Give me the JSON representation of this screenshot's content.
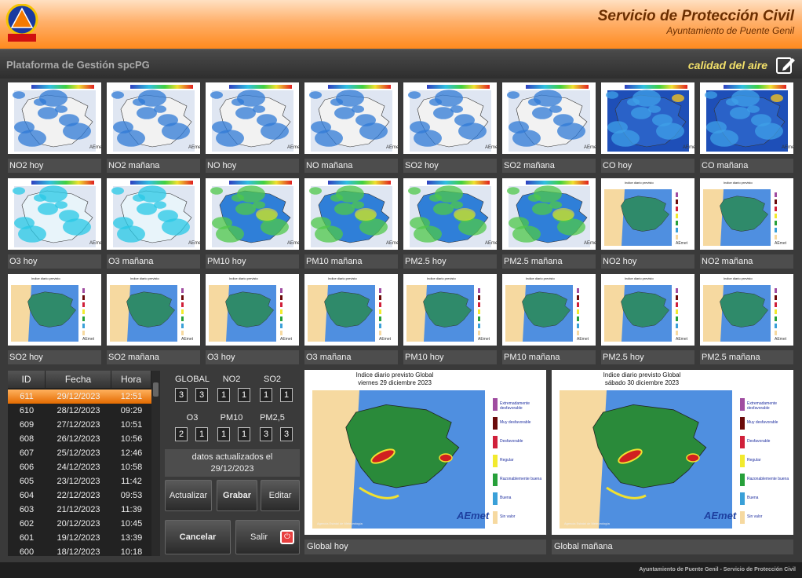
{
  "header": {
    "title": "Servicio de Protección Civil",
    "subtitle": "Ayuntamiento de Puente Genil",
    "logo_text": "PROTECCIÓN CIVIL Puente Genil"
  },
  "toolbar": {
    "platform": "Plataforma de Gestión spcPG",
    "section": "calidad del aire",
    "edit_icon": "edit-icon"
  },
  "rows": [
    [
      {
        "label": "NO2 hoy",
        "type": "grid"
      },
      {
        "label": "NO2 mañana",
        "type": "grid"
      },
      {
        "label": "NO hoy",
        "type": "grid"
      },
      {
        "label": "NO mañana",
        "type": "grid"
      },
      {
        "label": "SO2 hoy",
        "type": "grid"
      },
      {
        "label": "SO2 mañana",
        "type": "grid"
      },
      {
        "label": "CO hoy",
        "type": "dark"
      },
      {
        "label": "CO mañana",
        "type": "dark"
      }
    ],
    [
      {
        "label": "O3 hoy",
        "type": "cyan"
      },
      {
        "label": "O3 mañana",
        "type": "cyan"
      },
      {
        "label": "PM10 hoy",
        "type": "green"
      },
      {
        "label": "PM10 mañana",
        "type": "green"
      },
      {
        "label": "PM2.5 hoy",
        "type": "green"
      },
      {
        "label": "PM2.5 mañana",
        "type": "green"
      },
      {
        "label": "NO2 hoy",
        "type": "index"
      },
      {
        "label": "NO2 mañana",
        "type": "index"
      }
    ],
    [
      {
        "label": "SO2 hoy",
        "type": "index"
      },
      {
        "label": "SO2 mañana",
        "type": "index"
      },
      {
        "label": "O3 hoy",
        "type": "index"
      },
      {
        "label": "O3 mañana",
        "type": "index"
      },
      {
        "label": "PM10 hoy",
        "type": "index"
      },
      {
        "label": "PM10 mañana",
        "type": "index"
      },
      {
        "label": "PM2.5 hoy",
        "type": "index"
      },
      {
        "label": "PM2.5 mañana",
        "type": "index"
      }
    ]
  ],
  "table": {
    "headers": {
      "id": "ID",
      "fecha": "Fecha",
      "hora": "Hora"
    },
    "rows": [
      {
        "id": "611",
        "fecha": "29/12/2023",
        "hora": "12:51",
        "selected": true
      },
      {
        "id": "610",
        "fecha": "28/12/2023",
        "hora": "09:29"
      },
      {
        "id": "609",
        "fecha": "27/12/2023",
        "hora": "10:51"
      },
      {
        "id": "608",
        "fecha": "26/12/2023",
        "hora": "10:56"
      },
      {
        "id": "607",
        "fecha": "25/12/2023",
        "hora": "12:46"
      },
      {
        "id": "606",
        "fecha": "24/12/2023",
        "hora": "10:58"
      },
      {
        "id": "605",
        "fecha": "23/12/2023",
        "hora": "11:42"
      },
      {
        "id": "604",
        "fecha": "22/12/2023",
        "hora": "09:53"
      },
      {
        "id": "603",
        "fecha": "21/12/2023",
        "hora": "11:39"
      },
      {
        "id": "602",
        "fecha": "20/12/2023",
        "hora": "10:45"
      },
      {
        "id": "601",
        "fecha": "19/12/2023",
        "hora": "13:39"
      },
      {
        "id": "600",
        "fecha": "18/12/2023",
        "hora": "10:18"
      }
    ]
  },
  "indices": {
    "row1_labels": [
      "GLOBAL",
      "NO2",
      "SO2"
    ],
    "row1_values": [
      "3",
      "3",
      "1",
      "1",
      "1",
      "1"
    ],
    "row2_labels": [
      "O3",
      "PM10",
      "PM2,5"
    ],
    "row2_values": [
      "2",
      "1",
      "1",
      "1",
      "3",
      "3"
    ]
  },
  "update": {
    "line1": "datos actualizados el",
    "line2": "29/12/2023"
  },
  "buttons": {
    "actualizar": "Actualizar",
    "grabar": "Grabar",
    "editar": "Editar",
    "cancelar": "Cancelar",
    "salir": "Salir"
  },
  "global": [
    {
      "title1": "Indice diario previsto Global",
      "title2": "viernes 29 diciembre 2023",
      "label": "Global hoy"
    },
    {
      "title1": "Indice diario previsto Global",
      "title2": "sábado 30 diciembre 2023",
      "label": "Global mañana"
    }
  ],
  "legend": [
    "Extremadamente desfavorable",
    "Muy desfavorable",
    "Desfavorable",
    "Regular",
    "Razonablemente buena",
    "Buena",
    "Sin valor"
  ],
  "legend_colors": [
    "#a04ca0",
    "#6a0a0a",
    "#d0203a",
    "#f2ea2e",
    "#27a03a",
    "#3aa0d8",
    "#f6d9a0"
  ],
  "aemet": "AEmet",
  "aemet_foot": "Agencia Estatal de Meteorología",
  "footer": "Ayuntamiento de Puente Genil - Servicio de Protección Civil"
}
